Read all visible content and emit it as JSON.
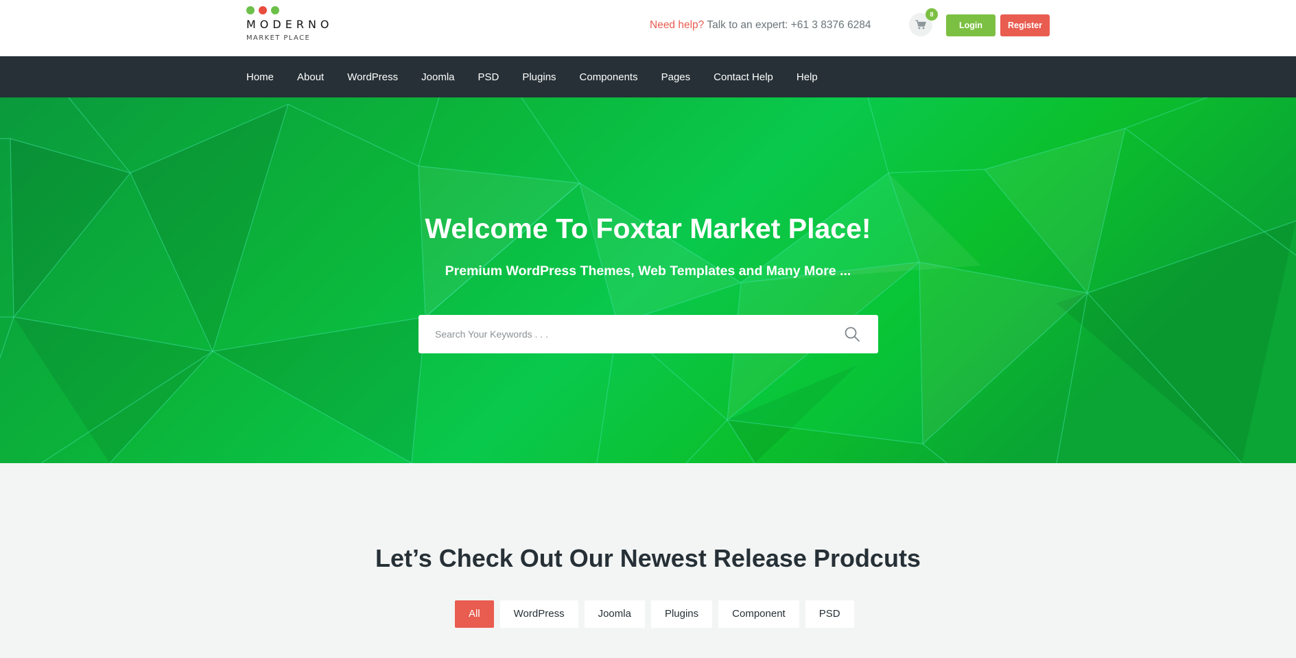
{
  "colors": {
    "accent_green": "#7cc043",
    "accent_red": "#e95c50",
    "nav_bg": "#263036",
    "hero_green": "#07b032"
  },
  "header": {
    "logo": {
      "dots": [
        "#6cc04a",
        "#e84c3d",
        "#6cc04a"
      ],
      "name": "MODERNO",
      "subtitle": "MARKET PLACE"
    },
    "help": {
      "prefix": "Need help?",
      "text": "Talk to an expert: +61 3 8376 6284"
    },
    "cart": {
      "icon": "cart-icon",
      "count": "8"
    },
    "login_label": "Login",
    "register_label": "Register"
  },
  "nav": {
    "items": [
      "Home",
      "About",
      "WordPress",
      "Joomla",
      "PSD",
      "Plugins",
      "Components",
      "Pages",
      "Contact Help",
      "Help"
    ]
  },
  "hero": {
    "title": "Welcome To Foxtar Market Place!",
    "subtitle": "Premium WordPress Themes, Web Templates and Many More ...",
    "search": {
      "placeholder": "Search Your Keywords . . .",
      "value": "",
      "icon": "search-icon"
    }
  },
  "newest": {
    "title": "Let’s Check Out Our Newest Release Prodcuts",
    "filters": [
      "All",
      "WordPress",
      "Joomla",
      "Plugins",
      "Component",
      "PSD"
    ],
    "active_filter": "All"
  }
}
